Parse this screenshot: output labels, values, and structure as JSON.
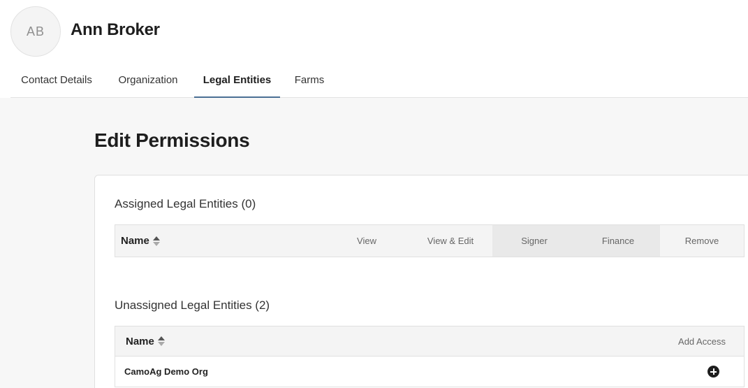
{
  "user": {
    "initials": "AB",
    "name": "Ann Broker"
  },
  "tabs": [
    {
      "label": "Contact Details",
      "active": false
    },
    {
      "label": "Organization",
      "active": false
    },
    {
      "label": "Legal Entities",
      "active": true
    },
    {
      "label": "Farms",
      "active": false
    }
  ],
  "page": {
    "title": "Edit Permissions"
  },
  "assigned": {
    "title": "Assigned Legal Entities (0)",
    "columns": {
      "name": "Name",
      "view": "View",
      "view_edit": "View & Edit",
      "signer": "Signer",
      "finance": "Finance",
      "remove": "Remove"
    },
    "rows": []
  },
  "unassigned": {
    "title": "Unassigned Legal Entities (2)",
    "columns": {
      "name": "Name",
      "add_access": "Add Access"
    },
    "rows": [
      {
        "name": "CamoAg Demo Org"
      }
    ]
  },
  "colors": {
    "accent": "#4a6f94",
    "background": "#f7f7f7"
  },
  "icons": {
    "sort": "sort-icon",
    "add": "plus-circle-icon"
  }
}
